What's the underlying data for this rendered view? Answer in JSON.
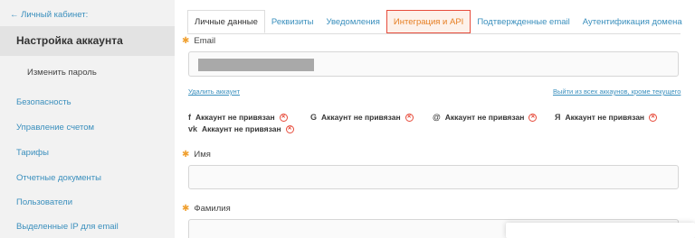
{
  "sidebar": {
    "back_label": "← Личный кабинет:",
    "title": "Настройка аккаунта",
    "items": [
      {
        "label": "Изменить пароль"
      },
      {
        "label": "Безопасность"
      },
      {
        "label": "Управление счетом"
      },
      {
        "label": "Тарифы"
      },
      {
        "label": "Отчетные документы"
      },
      {
        "label": "Пользователи"
      },
      {
        "label": "Выделенные IP для email"
      }
    ]
  },
  "tabs": [
    {
      "label": "Личные данные"
    },
    {
      "label": "Реквизиты"
    },
    {
      "label": "Уведомления"
    },
    {
      "label": "Интеграция и API"
    },
    {
      "label": "Подтвержденные email"
    },
    {
      "label": "Аутентификация домена"
    }
  ],
  "form": {
    "email_label": "Email",
    "email_value": "",
    "delete_account": "Удалить аккаунт",
    "logout_all": "Выйти из всех аккаунов, кроме текущего",
    "first_name_label": "Имя",
    "first_name_value": "",
    "last_name_label": "Фамилия",
    "last_name_value": ""
  },
  "socials": [
    {
      "icon": "f",
      "icon_name": "facebook-icon",
      "label": "Аккаунт не привязан"
    },
    {
      "icon": "G",
      "icon_name": "google-icon",
      "label": "Аккаунт не привязан"
    },
    {
      "icon": "@",
      "icon_name": "mail-ru-icon",
      "label": "Аккаунт не привязан"
    },
    {
      "icon": "Я",
      "icon_name": "yandex-icon",
      "label": "Аккаунт не привязан"
    },
    {
      "icon": "vk",
      "icon_name": "vk-icon",
      "label": "Аккаунт не привязан"
    }
  ],
  "colors": {
    "link": "#3a8fbd",
    "required": "#f0a030",
    "highlight_border": "#e74c3c",
    "highlight_text": "#e67e22"
  }
}
